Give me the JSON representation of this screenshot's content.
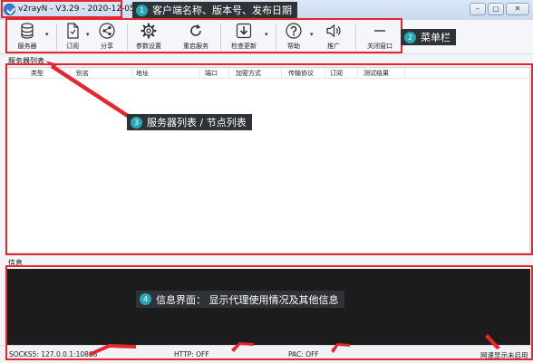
{
  "window": {
    "title": "v2rayN - V3.29 - 2020-12-05",
    "minimize_glyph": "–",
    "restore_glyph": "▢",
    "close_glyph": "✕"
  },
  "toolbar": {
    "items": [
      {
        "label": "服务器",
        "icon": "server-icon"
      },
      {
        "label": "订阅",
        "icon": "subscription-icon"
      },
      {
        "label": "分享",
        "icon": "share-icon"
      },
      {
        "label": "参数设置",
        "icon": "gear-icon"
      },
      {
        "label": "重启服务",
        "icon": "refresh-icon"
      },
      {
        "label": "检查更新",
        "icon": "download-icon"
      },
      {
        "label": "帮助",
        "icon": "help-icon"
      },
      {
        "label": "推广",
        "icon": "speaker-icon"
      },
      {
        "label": "关闭窗口",
        "icon": "minus-icon"
      }
    ],
    "dropdown_arrow": "▾"
  },
  "server_list": {
    "section_label": "服务器列表",
    "columns": [
      "类型",
      "别名",
      "地址",
      "端口",
      "加密方式",
      "传输协议",
      "订阅",
      "测试结果"
    ]
  },
  "info": {
    "section_label": "信息"
  },
  "statusbar": {
    "socks": "SOCKS5:  127.0.0.1:10808",
    "http": "HTTP:  OFF",
    "pac": "PAC:  OFF",
    "speed": "网速显示未启用"
  },
  "annotations": [
    {
      "num": "1",
      "text": "客户端名称、版本号、发布日期"
    },
    {
      "num": "2",
      "text": "菜单栏"
    },
    {
      "num": "3",
      "text": "服务器列表 / 节点列表"
    },
    {
      "num": "4",
      "text": "信息界面：  显示代理使用情况及其他信息"
    }
  ],
  "colors": {
    "annotation_red": "#e5262f",
    "annotation_badge": "#27a8b8",
    "annotation_label_bg": "#2f3236",
    "info_bg": "#1c1c1c"
  }
}
